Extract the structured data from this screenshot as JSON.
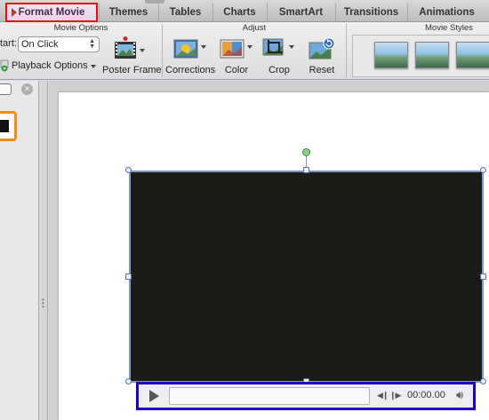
{
  "tabs": [
    {
      "label": "Format Movie",
      "active": true
    },
    {
      "label": "Themes"
    },
    {
      "label": "Tables"
    },
    {
      "label": "Charts"
    },
    {
      "label": "SmartArt"
    },
    {
      "label": "Transitions"
    },
    {
      "label": "Animations"
    }
  ],
  "ribbon": {
    "movie_options": {
      "header": "Movie Options",
      "start_label": "tart:",
      "start_value": "On Click",
      "playback_options": "Playback Options",
      "poster_frame": "Poster Frame"
    },
    "adjust": {
      "header": "Adjust",
      "corrections": "Corrections",
      "color": "Color",
      "crop": "Crop",
      "reset": "Reset"
    },
    "movie_styles": {
      "header": "Movie Styles"
    }
  },
  "player": {
    "time": "00:00.00"
  },
  "colors": {
    "active_tab_highlight": "#e21010",
    "playbar_highlight": "#1e00c8",
    "thumbnail_selection": "#f28c1e"
  },
  "icons": [
    "play-icon",
    "step-back-icon",
    "step-forward-icon",
    "volume-icon",
    "poster-frame-icon",
    "corrections-icon",
    "color-icon",
    "crop-icon",
    "reset-icon"
  ]
}
